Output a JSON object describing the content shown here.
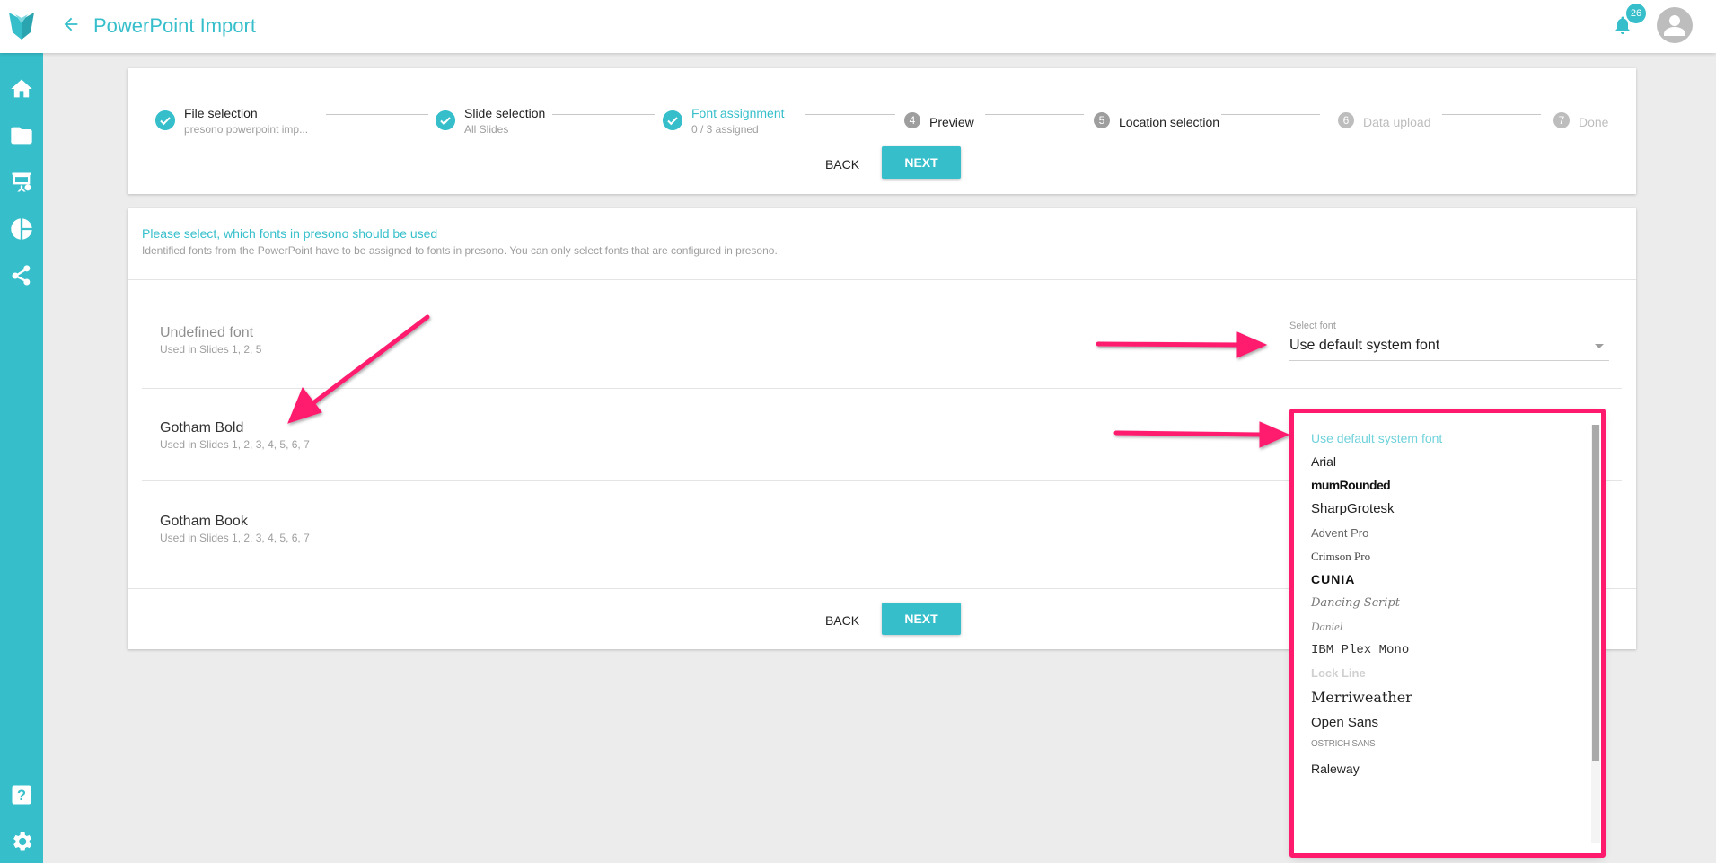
{
  "header": {
    "title": "PowerPoint Import",
    "notification_count": "26"
  },
  "stepper": {
    "steps": [
      {
        "label": "File selection",
        "sub": "presono powerpoint imp...",
        "state": "done"
      },
      {
        "label": "Slide selection",
        "sub": "All Slides",
        "state": "done"
      },
      {
        "label": "Font assignment",
        "sub": "0 / 3 assigned",
        "state": "active"
      },
      {
        "number": "4",
        "label": "Preview",
        "state": "pending"
      },
      {
        "number": "5",
        "label": "Location selection",
        "state": "pending"
      },
      {
        "number": "6",
        "label": "Data upload",
        "state": "disabled"
      },
      {
        "number": "7",
        "label": "Done",
        "state": "disabled"
      }
    ],
    "back_label": "Back",
    "next_label": "Next"
  },
  "fonts_panel": {
    "title": "Please select, which fonts in presono should be used",
    "subtitle": "Identified fonts from the PowerPoint have to be assigned to fonts in presono. You can only select fonts that are configured in presono.",
    "fonts": [
      {
        "name": "Undefined font",
        "used": "Used in Slides 1, 2, 5"
      },
      {
        "name": "Gotham Bold",
        "used": "Used in Slides 1, 2, 3, 4, 5, 6, 7"
      },
      {
        "name": "Gotham Book",
        "used": "Used in Slides 1, 2, 3, 4, 5, 6, 7"
      }
    ],
    "select_label": "Select font",
    "select_value": "Use default system font",
    "back_label": "Back",
    "next_label": "Next"
  },
  "dropdown": {
    "options": [
      "Use default system font",
      "Arial",
      "mumRounded",
      "SharpGrotesk",
      "Advent Pro",
      "Crimson Pro",
      "CUNIA",
      "Dancing Script",
      "Daniel",
      "IBM Plex Mono",
      "Lock Line",
      "Merriweather",
      "Open Sans",
      "OSTRICH SANS",
      "Raleway"
    ]
  },
  "colors": {
    "accent": "#36bfcb",
    "annotation": "#ff1a6e"
  },
  "icons": {
    "logo": "presono-logo",
    "back": "arrow-left-icon",
    "notifications": "bell-icon",
    "avatar": "user-icon",
    "sidebar": [
      "home-icon",
      "folder-icon",
      "presentation-icon",
      "pie-chart-icon",
      "share-icon",
      "help-icon",
      "settings-icon"
    ]
  }
}
